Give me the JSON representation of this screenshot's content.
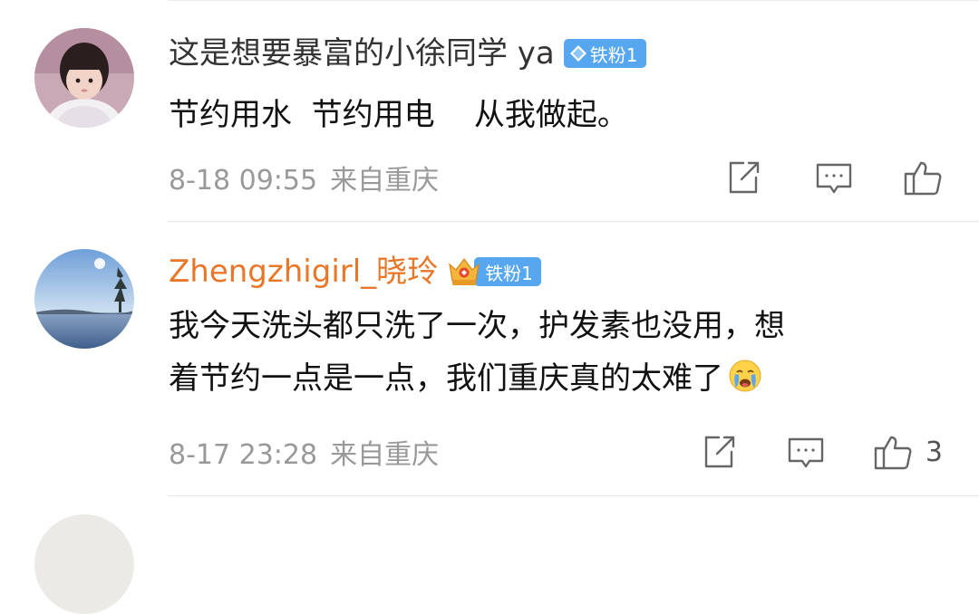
{
  "comments": [
    {
      "username": "这是想要暴富的小徐同学 ya",
      "badge": "铁粉1",
      "badge_icon": "diamond-icon",
      "text": "节约用水  节约用电    从我做起。",
      "date": "8-18 09:55",
      "location": "来自重庆",
      "likes": "",
      "avatar": "child-photo"
    },
    {
      "username": "Zhengzhigirl_晓玲",
      "badge": "铁粉1",
      "badge_icon": "crown-icon",
      "text_lines": [
        "我今天洗头都只洗了一次，护发素也没用，想",
        "着节约一点是一点，我们重庆真的太难了"
      ],
      "emoji": "crying-emoji-icon",
      "date": "8-17 23:28",
      "location": "来自重庆",
      "likes": "3",
      "avatar": "lake-landscape-photo"
    }
  ],
  "colors": {
    "username_default": "#333333",
    "username_vip": "#e8772a",
    "badge_bg": "#56a7f0",
    "meta": "#999999"
  }
}
